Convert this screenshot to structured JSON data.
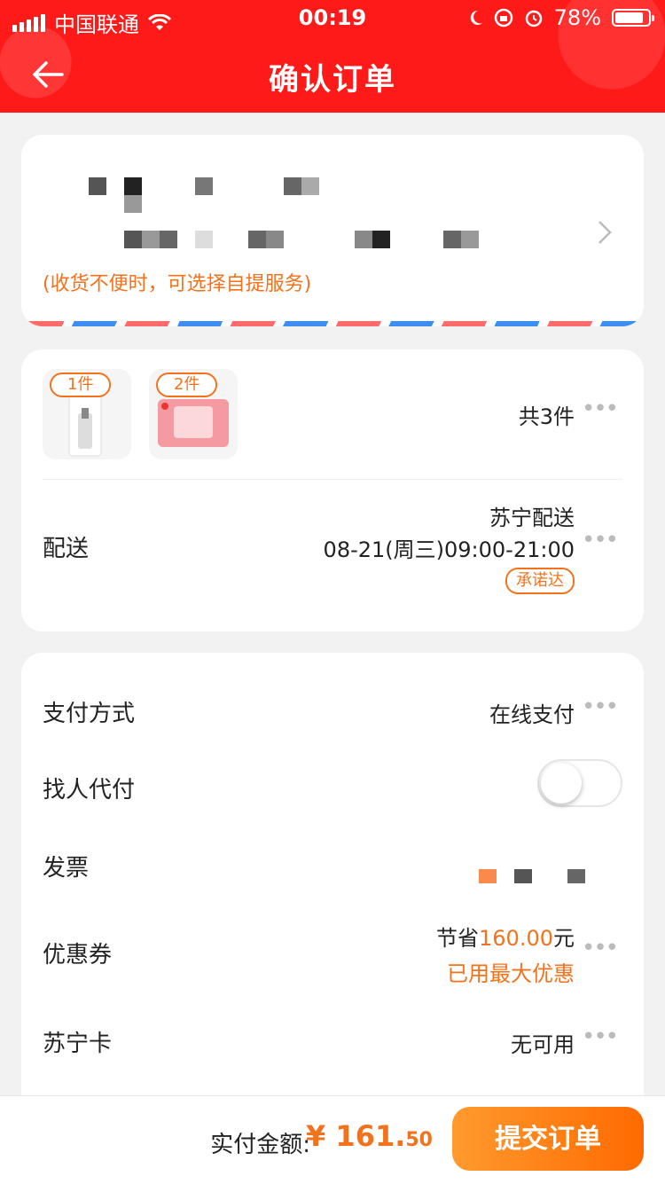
{
  "status_bar": {
    "carrier": "中国联通",
    "time": "00:19",
    "battery": "78%"
  },
  "header": {
    "title": "确认订单"
  },
  "address": {
    "note": "(收货不便时，可选择自提服务)"
  },
  "goods": {
    "items": [
      {
        "qty": "1件"
      },
      {
        "qty": "2件"
      }
    ],
    "total": "共3件"
  },
  "shipping": {
    "label": "配送",
    "method": "苏宁配送",
    "time": "08-21(周三)09:00-21:00",
    "badge": "承诺达"
  },
  "payment": {
    "label": "支付方式",
    "value": "在线支付"
  },
  "proxy_pay": {
    "label": "找人代付"
  },
  "invoice": {
    "label": "发票"
  },
  "coupon": {
    "label": "优惠券",
    "save_prefix": "节省",
    "save_amount": "160.00",
    "save_suffix": "元",
    "note": "已用最大优惠"
  },
  "card": {
    "label": "苏宁卡",
    "value": "无可用"
  },
  "bottom": {
    "pay_label": "实付金额:",
    "currency": "¥",
    "amount_int": "161.",
    "amount_dec": "50",
    "submit": "提交订单"
  },
  "colors": {
    "header_red": "#ff1a1a",
    "accent_orange": "#f4721c"
  }
}
